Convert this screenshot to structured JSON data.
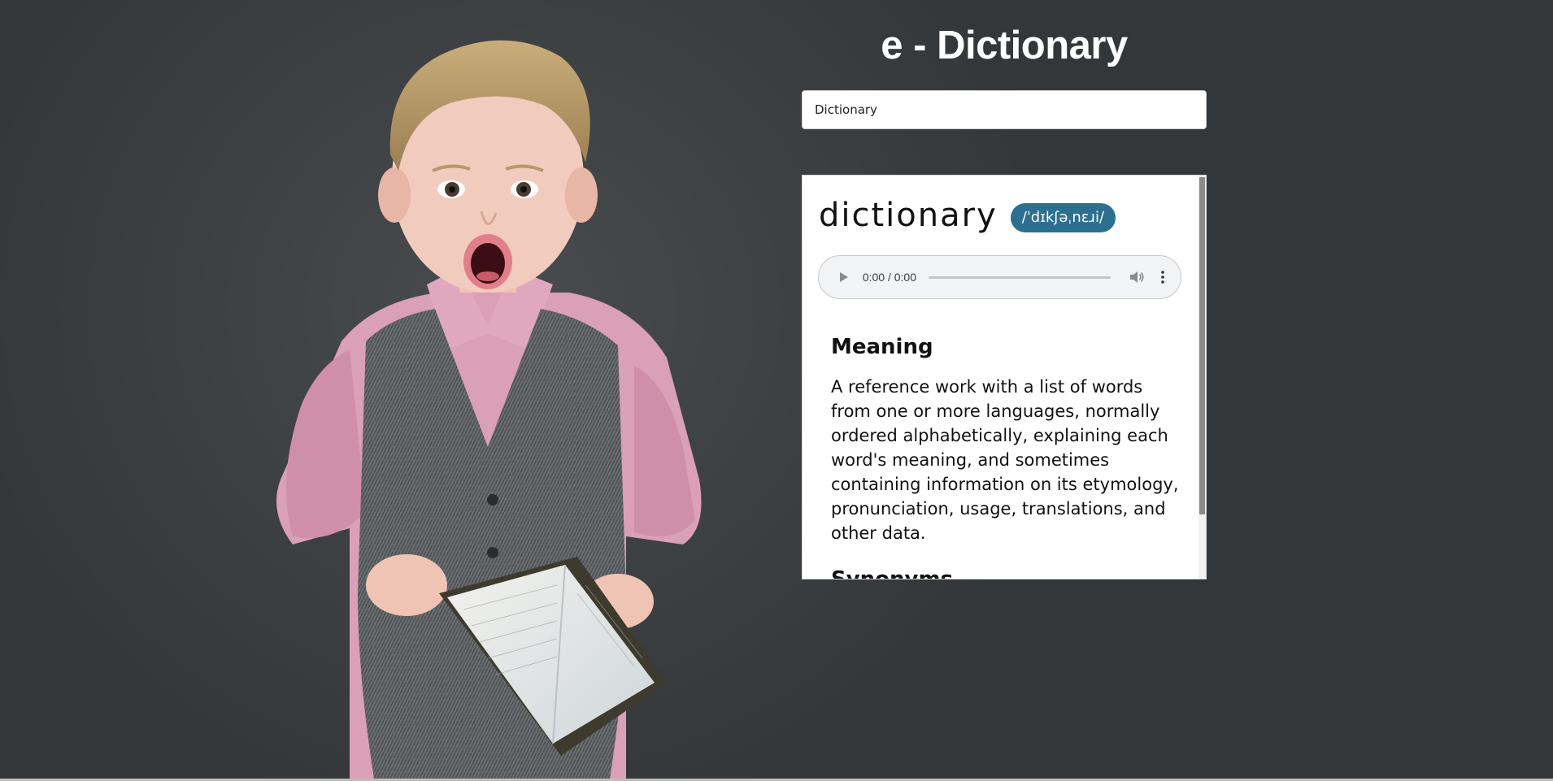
{
  "app": {
    "title": "e - Dictionary"
  },
  "search": {
    "value": "Dictionary"
  },
  "result": {
    "word": "dictionary",
    "phonetic": "/ˈdɪkʃəˌnɛɹi/",
    "audio": {
      "time": "0:00 / 0:00",
      "progress": 0
    },
    "meaning_heading": "Meaning",
    "meaning_text": "A reference work with a list of words from one or more languages, normally ordered alphabetically, explaining each word's meaning, and sometimes containing information on its etymology, pronunciation, usage, translations, and other data.",
    "synonyms_heading": "Synonyms"
  },
  "colors": {
    "background": "#3a3d40",
    "phonetic_badge": "#2c6f90",
    "card": "#ffffff"
  },
  "icons": [
    "play-icon",
    "volume-icon",
    "more-options-icon"
  ]
}
